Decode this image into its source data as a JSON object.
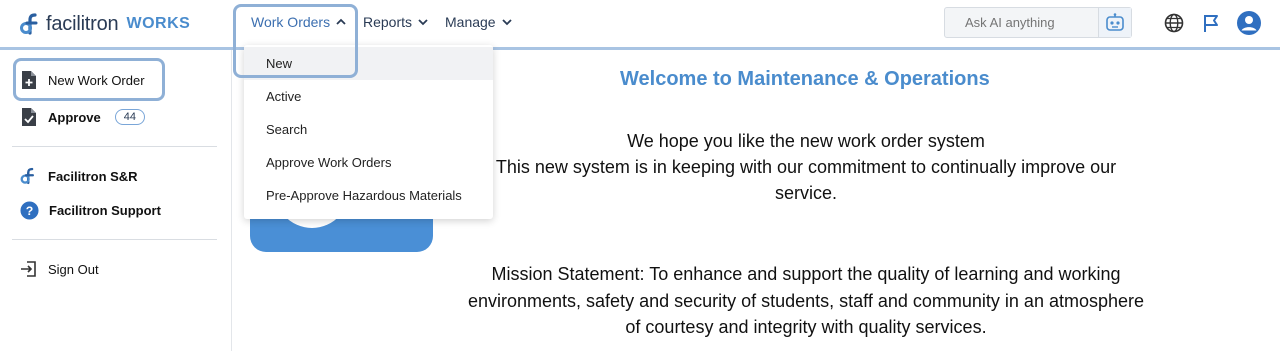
{
  "brand": {
    "name": "facilitron",
    "product": "WORKS"
  },
  "nav": {
    "items": [
      {
        "label": "Work Orders",
        "active": true,
        "chevron": "up"
      },
      {
        "label": "Reports",
        "active": false,
        "chevron": "down"
      },
      {
        "label": "Manage",
        "active": false,
        "chevron": "down"
      }
    ]
  },
  "ask_ai": {
    "placeholder": "Ask AI anything",
    "icon": "robot-icon"
  },
  "top_icons": [
    "globe-icon",
    "flag-icon",
    "user-avatar-icon"
  ],
  "sidebar": {
    "items": [
      {
        "label": "New Work Order",
        "icon": "new-document-icon"
      },
      {
        "label": "Approve",
        "icon": "approve-document-icon",
        "badge": "44"
      },
      {
        "label": "Facilitron S&R",
        "icon": "facilitron-logo-icon"
      },
      {
        "label": "Facilitron Support",
        "icon": "help-icon"
      },
      {
        "label": "Sign Out",
        "icon": "sign-out-icon"
      }
    ]
  },
  "dropdown": {
    "items": [
      {
        "label": "New"
      },
      {
        "label": "Active"
      },
      {
        "label": "Search"
      },
      {
        "label": "Approve Work Orders"
      },
      {
        "label": "Pre-Approve Hazardous Materials"
      }
    ]
  },
  "main": {
    "welcome": "Welcome to Maintenance & Operations",
    "intro_lines": [
      "We hope you like the new work order system",
      "This new system is in keeping with our commitment to continually improve our",
      "service."
    ],
    "mission_lines": [
      "Mission Statement: To enhance and support the quality of learning and working",
      "environments, safety and security of students, staff and community in an atmosphere",
      "of courtesy and integrity with quality services."
    ]
  },
  "colors": {
    "accent": "#4a8ccd",
    "focus_ring": "#8fb0d6",
    "hero": "#4a8fd6"
  }
}
